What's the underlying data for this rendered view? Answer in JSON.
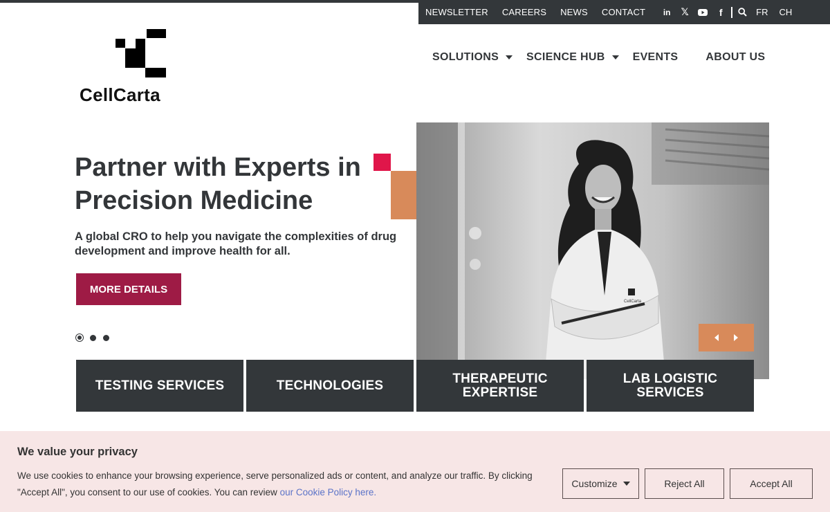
{
  "utility_nav": {
    "links": [
      "NEWSLETTER",
      "CAREERS",
      "NEWS",
      "CONTACT"
    ],
    "social_icons": [
      "linkedin-icon",
      "x-icon",
      "youtube-icon",
      "facebook-icon",
      "search-icon"
    ],
    "social_labels": {
      "linkedin": "in",
      "x": "𝕏",
      "youtube": "▶",
      "facebook": "f"
    },
    "languages": [
      "FR",
      "CH"
    ]
  },
  "brand": {
    "name": "CellCarta"
  },
  "main_nav": {
    "items": [
      {
        "label": "SOLUTIONS",
        "dropdown": true
      },
      {
        "label": "SCIENCE HUB",
        "dropdown": true
      },
      {
        "label": "EVENTS",
        "dropdown": false
      },
      {
        "label": "ABOUT US",
        "dropdown": false
      }
    ]
  },
  "hero": {
    "title": "Partner with Experts in Precision Medicine",
    "subtitle": "A global CRO to help you navigate the complexities of drug development and improve health for all.",
    "button": "MORE DETAILS",
    "slides_total": 3,
    "active_slide": 1,
    "accent_colors": {
      "red": "#e0164a",
      "orange": "#d88a5a",
      "button": "#9e1b45"
    },
    "image_badge_text": "CellCarta"
  },
  "tiles": [
    "TESTING SERVICES",
    "TECHNOLOGIES",
    "THERAPEUTIC EXPERTISE",
    "LAB LOGISTIC SERVICES"
  ],
  "cookie_banner": {
    "title": "We value your privacy",
    "text": "We use cookies to enhance your browsing experience, serve personalized ads or content, and analyze our traffic. By clicking \"Accept All\", you consent to our use of cookies. You can review ",
    "link_text": "our Cookie Policy here.",
    "buttons": {
      "customize": "Customize",
      "reject": "Reject All",
      "accept": "Accept All"
    }
  }
}
